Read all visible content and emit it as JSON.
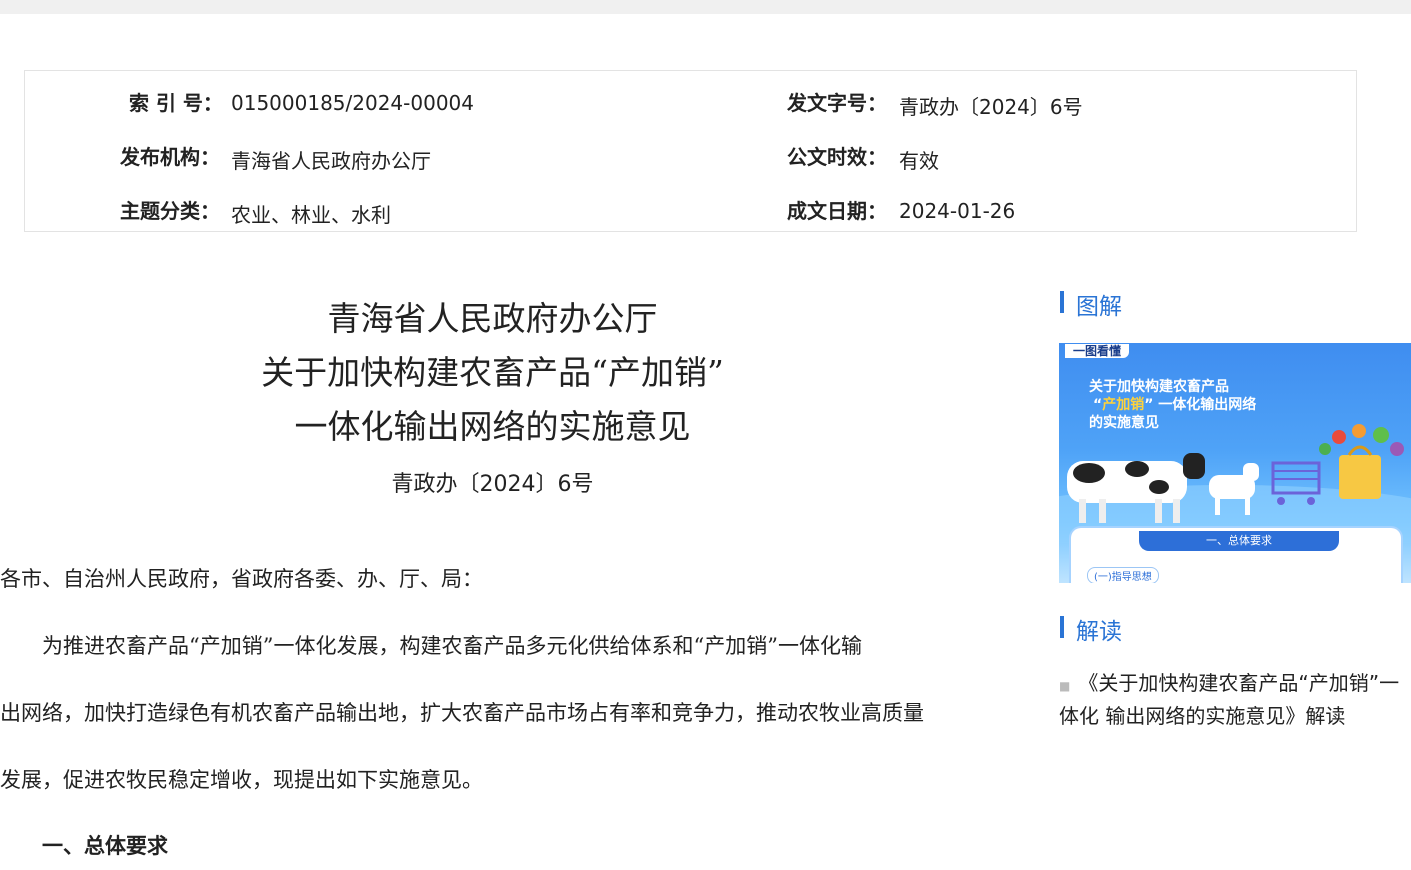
{
  "meta": {
    "index_label": "索 引 号：",
    "index_value": "015000185/2024-00004",
    "doc_code_label": "发文字号：",
    "doc_code_value": "青政办〔2024〕6号",
    "publisher_label": "发布机构：",
    "publisher_value": "青海省人民政府办公厅",
    "validity_label": "公文时效：",
    "validity_value": "有效",
    "topic_label": "主题分类：",
    "topic_value": "农业、林业、水利",
    "date_label": "成文日期：",
    "date_value": "2024-01-26"
  },
  "document": {
    "title_lines": [
      "青海省人民政府办公厅",
      "关于加快构建农畜产品“产加销”",
      "一体化输出网络的实施意见"
    ],
    "doc_number": "青政办〔2024〕6号",
    "salutation": "各市、自治州人民政府，省政府各委、办、厅、局：",
    "body_lines": [
      "为推进农畜产品“产加销”一体化发展，构建农畜产品多元化供给体系和“产加销”一体化输",
      "出网络，加快打造绿色有机农畜产品输出地，扩大农畜产品市场占有率和竞争力，推动农牧业高质量",
      "发展，促进农牧民稳定增收，现提出如下实施意见。"
    ],
    "section_heading": "一、总体要求"
  },
  "sidebar": {
    "infographic_heading": "图解",
    "interpretation_heading": "解读",
    "infographic": {
      "tag": "一图看懂",
      "title_line1": "关于加快构建农畜产品",
      "title_line2_quote_open": "“",
      "title_line2_highlight": "产加销",
      "title_line2_rest": "” 一体化输出网络",
      "title_line3": "的实施意见",
      "pill": "一、总体要求",
      "sub": "(一)指导思想"
    },
    "interpretation_link": "《关于加快构建农畜产品“产加销”一体化 输出网络的实施意见》解读"
  }
}
